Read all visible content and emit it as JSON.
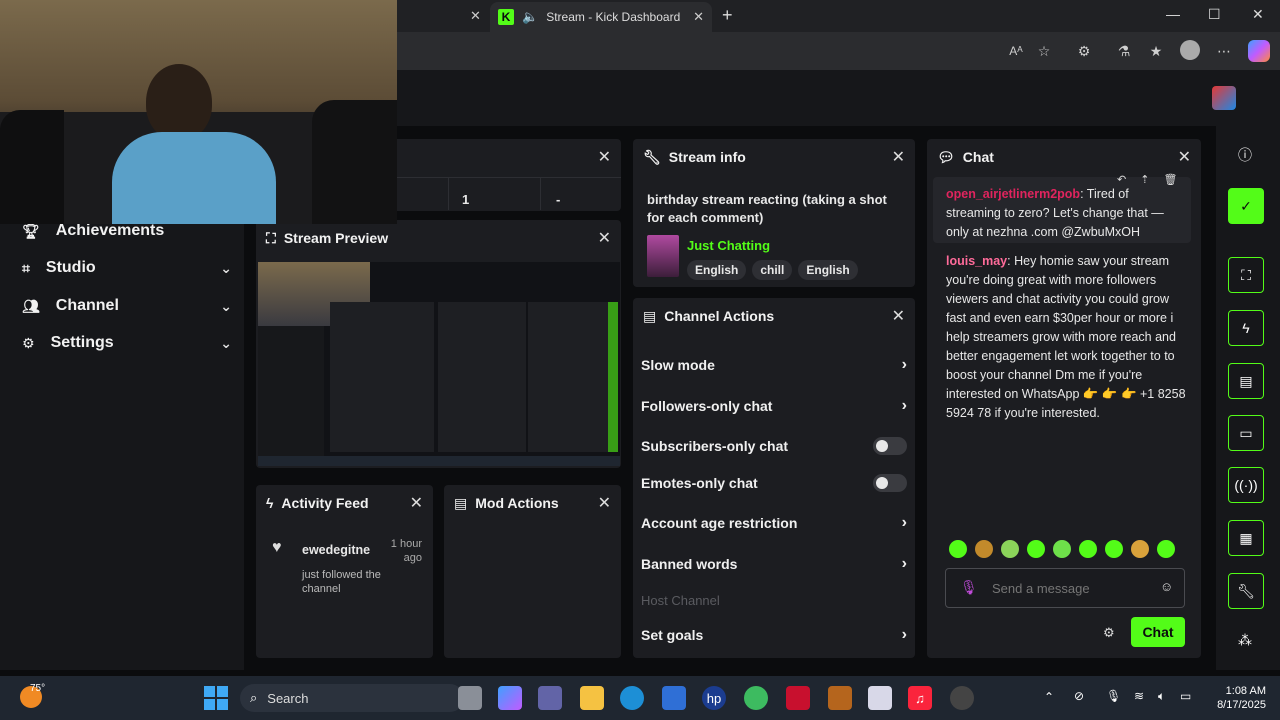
{
  "browser": {
    "active_tab_title": "Stream - Kick Dashboard",
    "window_controls": [
      "—",
      "☐",
      "✕"
    ]
  },
  "nav": {
    "items": [
      {
        "label": "Achievements",
        "icon": "trophy-icon"
      },
      {
        "label": "Studio",
        "icon": "studio-icon"
      },
      {
        "label": "Channel",
        "icon": "channel-icon"
      },
      {
        "label": "Settings",
        "icon": "gear-icon"
      }
    ]
  },
  "partial_panel": {
    "cell_1": "1",
    "cell_2": "-"
  },
  "stream_preview": {
    "title": "Stream Preview"
  },
  "stream_info": {
    "title": "Stream info",
    "stream_title": "birthday stream reacting (taking a shot for each comment)",
    "category": "Just Chatting",
    "tags": [
      "English",
      "chill",
      "English"
    ]
  },
  "channel_actions": {
    "title": "Channel Actions",
    "items": [
      {
        "label": "Slow mode",
        "type": "chevron"
      },
      {
        "label": "Followers-only chat",
        "type": "chevron"
      },
      {
        "label": "Subscribers-only chat",
        "type": "toggle"
      },
      {
        "label": "Emotes-only chat",
        "type": "toggle"
      },
      {
        "label": "Account age restriction",
        "type": "chevron"
      },
      {
        "label": "Banned words",
        "type": "chevron"
      },
      {
        "label": "Host Channel",
        "type": "disabled"
      },
      {
        "label": "Set goals",
        "type": "chevron"
      }
    ]
  },
  "activity_feed": {
    "title": "Activity Feed",
    "event_user": "ewedegitne",
    "event_time": "1 hour ago",
    "event_text": "just followed the channel"
  },
  "mod_actions": {
    "title": "Mod Actions"
  },
  "chat": {
    "title": "Chat",
    "messages": [
      {
        "user": "open_airjetlinerm2pob",
        "user_color": "#e0245e",
        "text": "Tired of streaming to zero? Let's change that — only at nezhna .com @ZwbuMxOH"
      },
      {
        "user": "louis_may",
        "user_color": "#ff6b9a",
        "text": "Hey homie saw your stream you're doing great with more followers viewers and chat activity you could grow fast and even earn $30per hour or more i help streamers grow with more reach and better engagement let work together to to boost your channel Dm me if you're interested on WhatsApp 👉 👉 👉 +1 8258 5924 78 if you're interested."
      }
    ],
    "input_placeholder": "Send a message",
    "send_label": "Chat"
  },
  "taskbar": {
    "weather": "75°",
    "search_label": "Search",
    "time": "1:08 AM",
    "date": "8/17/2025"
  },
  "colors": {
    "accent": "#53fc18",
    "panel": "#1c1d21",
    "background": "#0b0c0e"
  }
}
